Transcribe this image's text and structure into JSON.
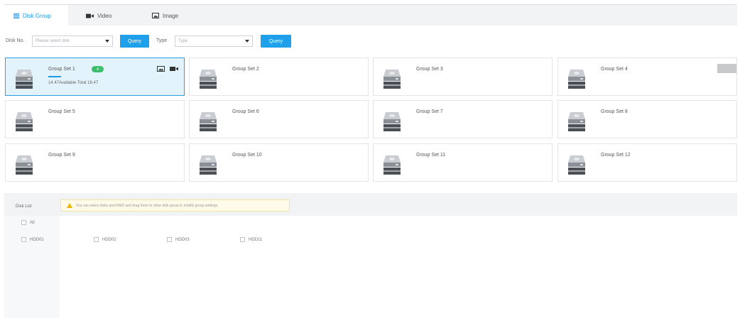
{
  "tabs": [
    {
      "label": "Disk Group",
      "icon": "list-icon",
      "active": true
    },
    {
      "label": "Video",
      "icon": "video-camera-icon",
      "active": false
    },
    {
      "label": "Image",
      "icon": "image-icon",
      "active": false
    }
  ],
  "filters": {
    "disk_no_label": "Disk No.",
    "disk_placeholder": "Please select disk",
    "query1": "Query",
    "type_label": "Type",
    "type_placeholder": "Type",
    "query2": "Query"
  },
  "groups": [
    {
      "name": "Group Set 1",
      "badge": "4",
      "capacity": "14.47Available Total 16.47",
      "selected": true
    },
    {
      "name": "Group Set 2"
    },
    {
      "name": "Group Set 3"
    },
    {
      "name": "Group Set 4"
    },
    {
      "name": "Group Set 5"
    },
    {
      "name": "Group Set 6"
    },
    {
      "name": "Group Set 7"
    },
    {
      "name": "Group Set 8"
    },
    {
      "name": "Group Set 9"
    },
    {
      "name": "Group Set 10"
    },
    {
      "name": "Group Set 11"
    },
    {
      "name": "Group Set 12"
    }
  ],
  "disk_list": {
    "label": "Disk List",
    "note": "You can select disks and RAID and drag them to other disk group to modify group settings.",
    "all_label": "All",
    "disks": [
      "HDD01",
      "HDD02",
      "HDD03",
      "HDD11"
    ]
  },
  "colors": {
    "accent": "#1e9ae6",
    "badge": "#3cbf6c",
    "warning": "#f0b400"
  }
}
